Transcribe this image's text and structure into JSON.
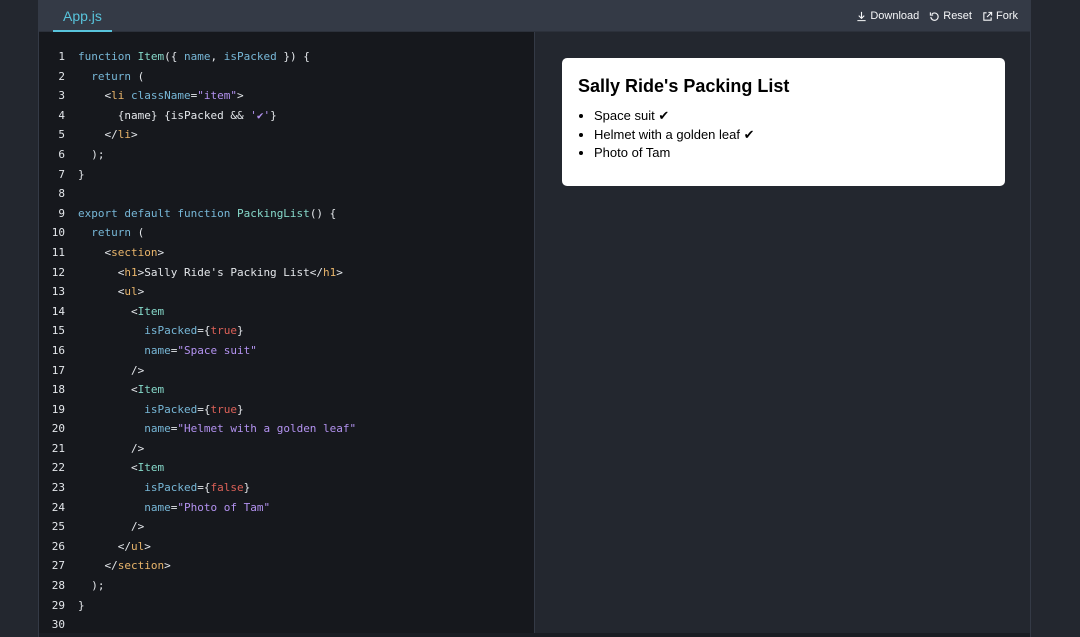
{
  "toolbar": {
    "tab_label": "App.js",
    "download_label": "Download",
    "reset_label": "Reset",
    "fork_label": "Fork"
  },
  "editor": {
    "lines": [
      {
        "n": "1",
        "tokens": [
          [
            "kw",
            "function "
          ],
          [
            "fn",
            "Item"
          ],
          [
            "pl",
            "({ "
          ],
          [
            "var",
            "name"
          ],
          [
            "pl",
            ", "
          ],
          [
            "var",
            "isPacked"
          ],
          [
            "pl",
            " }) {"
          ]
        ]
      },
      {
        "n": "2",
        "tokens": [
          [
            "pl",
            "  "
          ],
          [
            "kw",
            "return"
          ],
          [
            "pl",
            " ("
          ]
        ]
      },
      {
        "n": "3",
        "tokens": [
          [
            "pl",
            "    <"
          ],
          [
            "tag",
            "li"
          ],
          [
            "pl",
            " "
          ],
          [
            "attr",
            "className"
          ],
          [
            "pl",
            "="
          ],
          [
            "str",
            "\"item\""
          ],
          [
            "pl",
            ">"
          ]
        ]
      },
      {
        "n": "4",
        "tokens": [
          [
            "pl",
            "      {name} {"
          ],
          [
            "sel",
            "isPacked"
          ],
          [
            "pl",
            " && "
          ],
          [
            "str",
            "'✔'"
          ],
          [
            "pl",
            "}"
          ]
        ]
      },
      {
        "n": "5",
        "tokens": [
          [
            "pl",
            "    </"
          ],
          [
            "tag",
            "li"
          ],
          [
            "pl",
            ">"
          ]
        ]
      },
      {
        "n": "6",
        "tokens": [
          [
            "pl",
            "  );"
          ]
        ]
      },
      {
        "n": "7",
        "tokens": [
          [
            "pl",
            "}"
          ]
        ]
      },
      {
        "n": "8",
        "tokens": [
          [
            "pl",
            ""
          ]
        ]
      },
      {
        "n": "9",
        "tokens": [
          [
            "kw",
            "export default function "
          ],
          [
            "fn",
            "PackingList"
          ],
          [
            "pl",
            "() {"
          ]
        ]
      },
      {
        "n": "10",
        "tokens": [
          [
            "pl",
            "  "
          ],
          [
            "kw",
            "return"
          ],
          [
            "pl",
            " ("
          ]
        ]
      },
      {
        "n": "11",
        "tokens": [
          [
            "pl",
            "    <"
          ],
          [
            "tag",
            "section"
          ],
          [
            "pl",
            ">"
          ]
        ]
      },
      {
        "n": "12",
        "tokens": [
          [
            "pl",
            "      <"
          ],
          [
            "tag",
            "h1"
          ],
          [
            "pl",
            ">Sally Ride's Packing List</"
          ],
          [
            "tag",
            "h1"
          ],
          [
            "pl",
            ">"
          ]
        ]
      },
      {
        "n": "13",
        "tokens": [
          [
            "pl",
            "      <"
          ],
          [
            "tag",
            "ul"
          ],
          [
            "pl",
            ">"
          ]
        ]
      },
      {
        "n": "14",
        "tokens": [
          [
            "pl",
            "        <"
          ],
          [
            "fn",
            "Item"
          ]
        ]
      },
      {
        "n": "15",
        "tokens": [
          [
            "pl",
            "          "
          ],
          [
            "attr",
            "isPacked"
          ],
          [
            "pl",
            "={"
          ],
          [
            "bool",
            "true"
          ],
          [
            "pl",
            "}"
          ]
        ]
      },
      {
        "n": "16",
        "tokens": [
          [
            "pl",
            "          "
          ],
          [
            "attr",
            "name"
          ],
          [
            "pl",
            "="
          ],
          [
            "str",
            "\"Space suit\""
          ]
        ]
      },
      {
        "n": "17",
        "tokens": [
          [
            "pl",
            "        />"
          ]
        ]
      },
      {
        "n": "18",
        "tokens": [
          [
            "pl",
            "        <"
          ],
          [
            "fn",
            "Item"
          ]
        ]
      },
      {
        "n": "19",
        "tokens": [
          [
            "pl",
            "          "
          ],
          [
            "attr",
            "isPacked"
          ],
          [
            "pl",
            "={"
          ],
          [
            "bool",
            "true"
          ],
          [
            "pl",
            "}"
          ]
        ]
      },
      {
        "n": "20",
        "tokens": [
          [
            "pl",
            "          "
          ],
          [
            "attr",
            "name"
          ],
          [
            "pl",
            "="
          ],
          [
            "str",
            "\"Helmet with a golden leaf\""
          ]
        ]
      },
      {
        "n": "21",
        "tokens": [
          [
            "pl",
            "        />"
          ]
        ]
      },
      {
        "n": "22",
        "tokens": [
          [
            "pl",
            "        <"
          ],
          [
            "fn",
            "Item"
          ]
        ]
      },
      {
        "n": "23",
        "tokens": [
          [
            "pl",
            "          "
          ],
          [
            "attr",
            "isPacked"
          ],
          [
            "pl",
            "={"
          ],
          [
            "bool",
            "false"
          ],
          [
            "pl",
            "}"
          ]
        ]
      },
      {
        "n": "24",
        "tokens": [
          [
            "pl",
            "          "
          ],
          [
            "attr",
            "name"
          ],
          [
            "pl",
            "="
          ],
          [
            "str",
            "\"Photo of Tam\""
          ]
        ]
      },
      {
        "n": "25",
        "tokens": [
          [
            "pl",
            "        />"
          ]
        ]
      },
      {
        "n": "26",
        "tokens": [
          [
            "pl",
            "      </"
          ],
          [
            "tag",
            "ul"
          ],
          [
            "pl",
            ">"
          ]
        ]
      },
      {
        "n": "27",
        "tokens": [
          [
            "pl",
            "    </"
          ],
          [
            "tag",
            "section"
          ],
          [
            "pl",
            ">"
          ]
        ]
      },
      {
        "n": "28",
        "tokens": [
          [
            "pl",
            "  );"
          ]
        ]
      },
      {
        "n": "29",
        "tokens": [
          [
            "pl",
            "}"
          ]
        ]
      },
      {
        "n": "30",
        "tokens": [
          [
            "pl",
            ""
          ]
        ]
      }
    ]
  },
  "preview": {
    "title": "Sally Ride's Packing List",
    "items": [
      "Space suit ✔",
      "Helmet with a golden leaf ✔",
      "Photo of Tam"
    ]
  },
  "colors": {
    "accent": "#58c4dc",
    "editor_bg": "#16181d",
    "preview_bg": "#23272f"
  }
}
